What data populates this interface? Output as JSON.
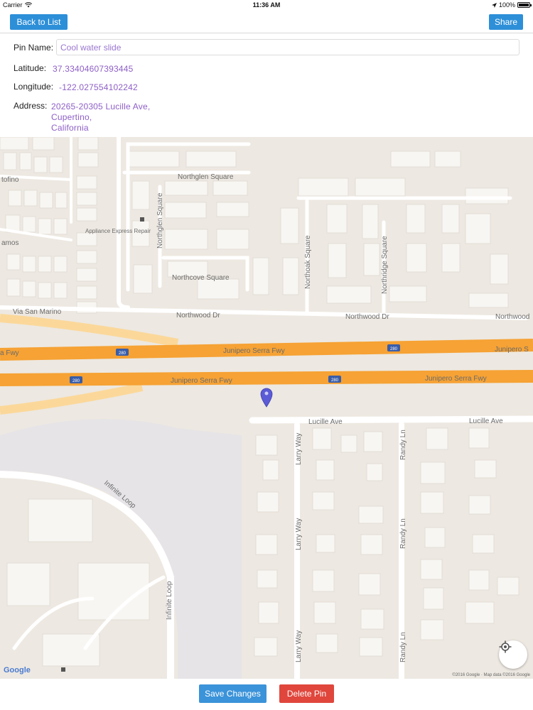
{
  "status_bar": {
    "carrier": "Carrier",
    "time": "11:36 AM",
    "battery": "100%"
  },
  "nav": {
    "back_label": "Back to List",
    "share_label": "Share"
  },
  "form": {
    "pin_name_label": "Pin Name:",
    "pin_name_value": "Cool water slide",
    "latitude_label": "Latitude:",
    "latitude_value": "37.33404607393445",
    "longitude_label": "Longitude:",
    "longitude_value": "-122.027554102242",
    "address_label": "Address:",
    "address_lines": [
      "20265-20305 Lucille Ave,",
      "Cupertino,",
      "California"
    ]
  },
  "map": {
    "labels": {
      "northglen_square": "Northglen Square",
      "northglen_square_vertical": "Northglen Square",
      "appliance": "Appliance Express Repair",
      "tofino": "tofino",
      "amos": "amos",
      "northcove_square": "Northcove Square",
      "northoak_square": "Northoak Square",
      "northridge_square": "Northridge Square",
      "via_san_marino": "Via San Marino",
      "northwood_dr_1": "Northwood Dr",
      "northwood_dr_2": "Northwood Dr",
      "northwood_dr_3": "Northwood",
      "fwy_top_left": "a Fwy",
      "fwy_top_mid": "Junipero Serra Fwy",
      "fwy_top_right": "Junipero S",
      "fwy_bottom_mid": "Junipero Serra Fwy",
      "fwy_bottom_right": "Junipero Serra Fwy",
      "shield_280": "280",
      "lucille_ave_1": "Lucille Ave",
      "lucille_ave_2": "Lucille Ave",
      "infinite_loop_1": "Infinite Loop",
      "infinite_loop_2": "Infinite Loop",
      "larry_way_1": "Larry Way",
      "larry_way_2": "Larry Way",
      "larry_way_3": "Larry Way",
      "randy_ln_1": "Randy Ln",
      "randy_ln_2": "Randy Ln",
      "randy_ln_3": "Randy Ln"
    },
    "google_logo": "Google",
    "credit": "©2016 Google · Map data ©2016 Google",
    "pin_color": "#5b5bd6",
    "freeway_color": "#f6a234"
  },
  "actions": {
    "save_label": "Save Changes",
    "delete_label": "Delete Pin"
  },
  "colors": {
    "accent": "#2d8fd8",
    "danger": "#e0463c",
    "value_text": "#8e5fc7"
  }
}
